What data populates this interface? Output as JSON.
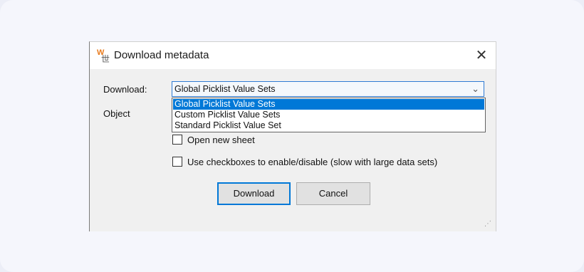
{
  "dialog": {
    "title": "Download metadata",
    "close_glyph": "✕",
    "icon": {
      "w": "W",
      "g": "世"
    },
    "download_label": "Download:",
    "object_label": "Object",
    "combo_value": "Global Picklist Value Sets",
    "chevron": "⌄",
    "options": [
      "Global Picklist Value Sets",
      "Custom Picklist Value Sets",
      "Standard Picklist Value Set"
    ],
    "selected_index": 0,
    "open_new_sheet_label": "Open new sheet",
    "open_new_sheet_checked": false,
    "use_checkboxes_label": "Use checkboxes to enable/disable (slow with large data sets)",
    "use_checkboxes_checked": false,
    "download_button": "Download",
    "cancel_button": "Cancel",
    "resize_grip": "⋰"
  },
  "colors": {
    "accent": "#0078d7",
    "combo_border": "#2f7bd3",
    "dialog_bg": "#f0f0f0",
    "page_bg": "#f5f6fc"
  }
}
